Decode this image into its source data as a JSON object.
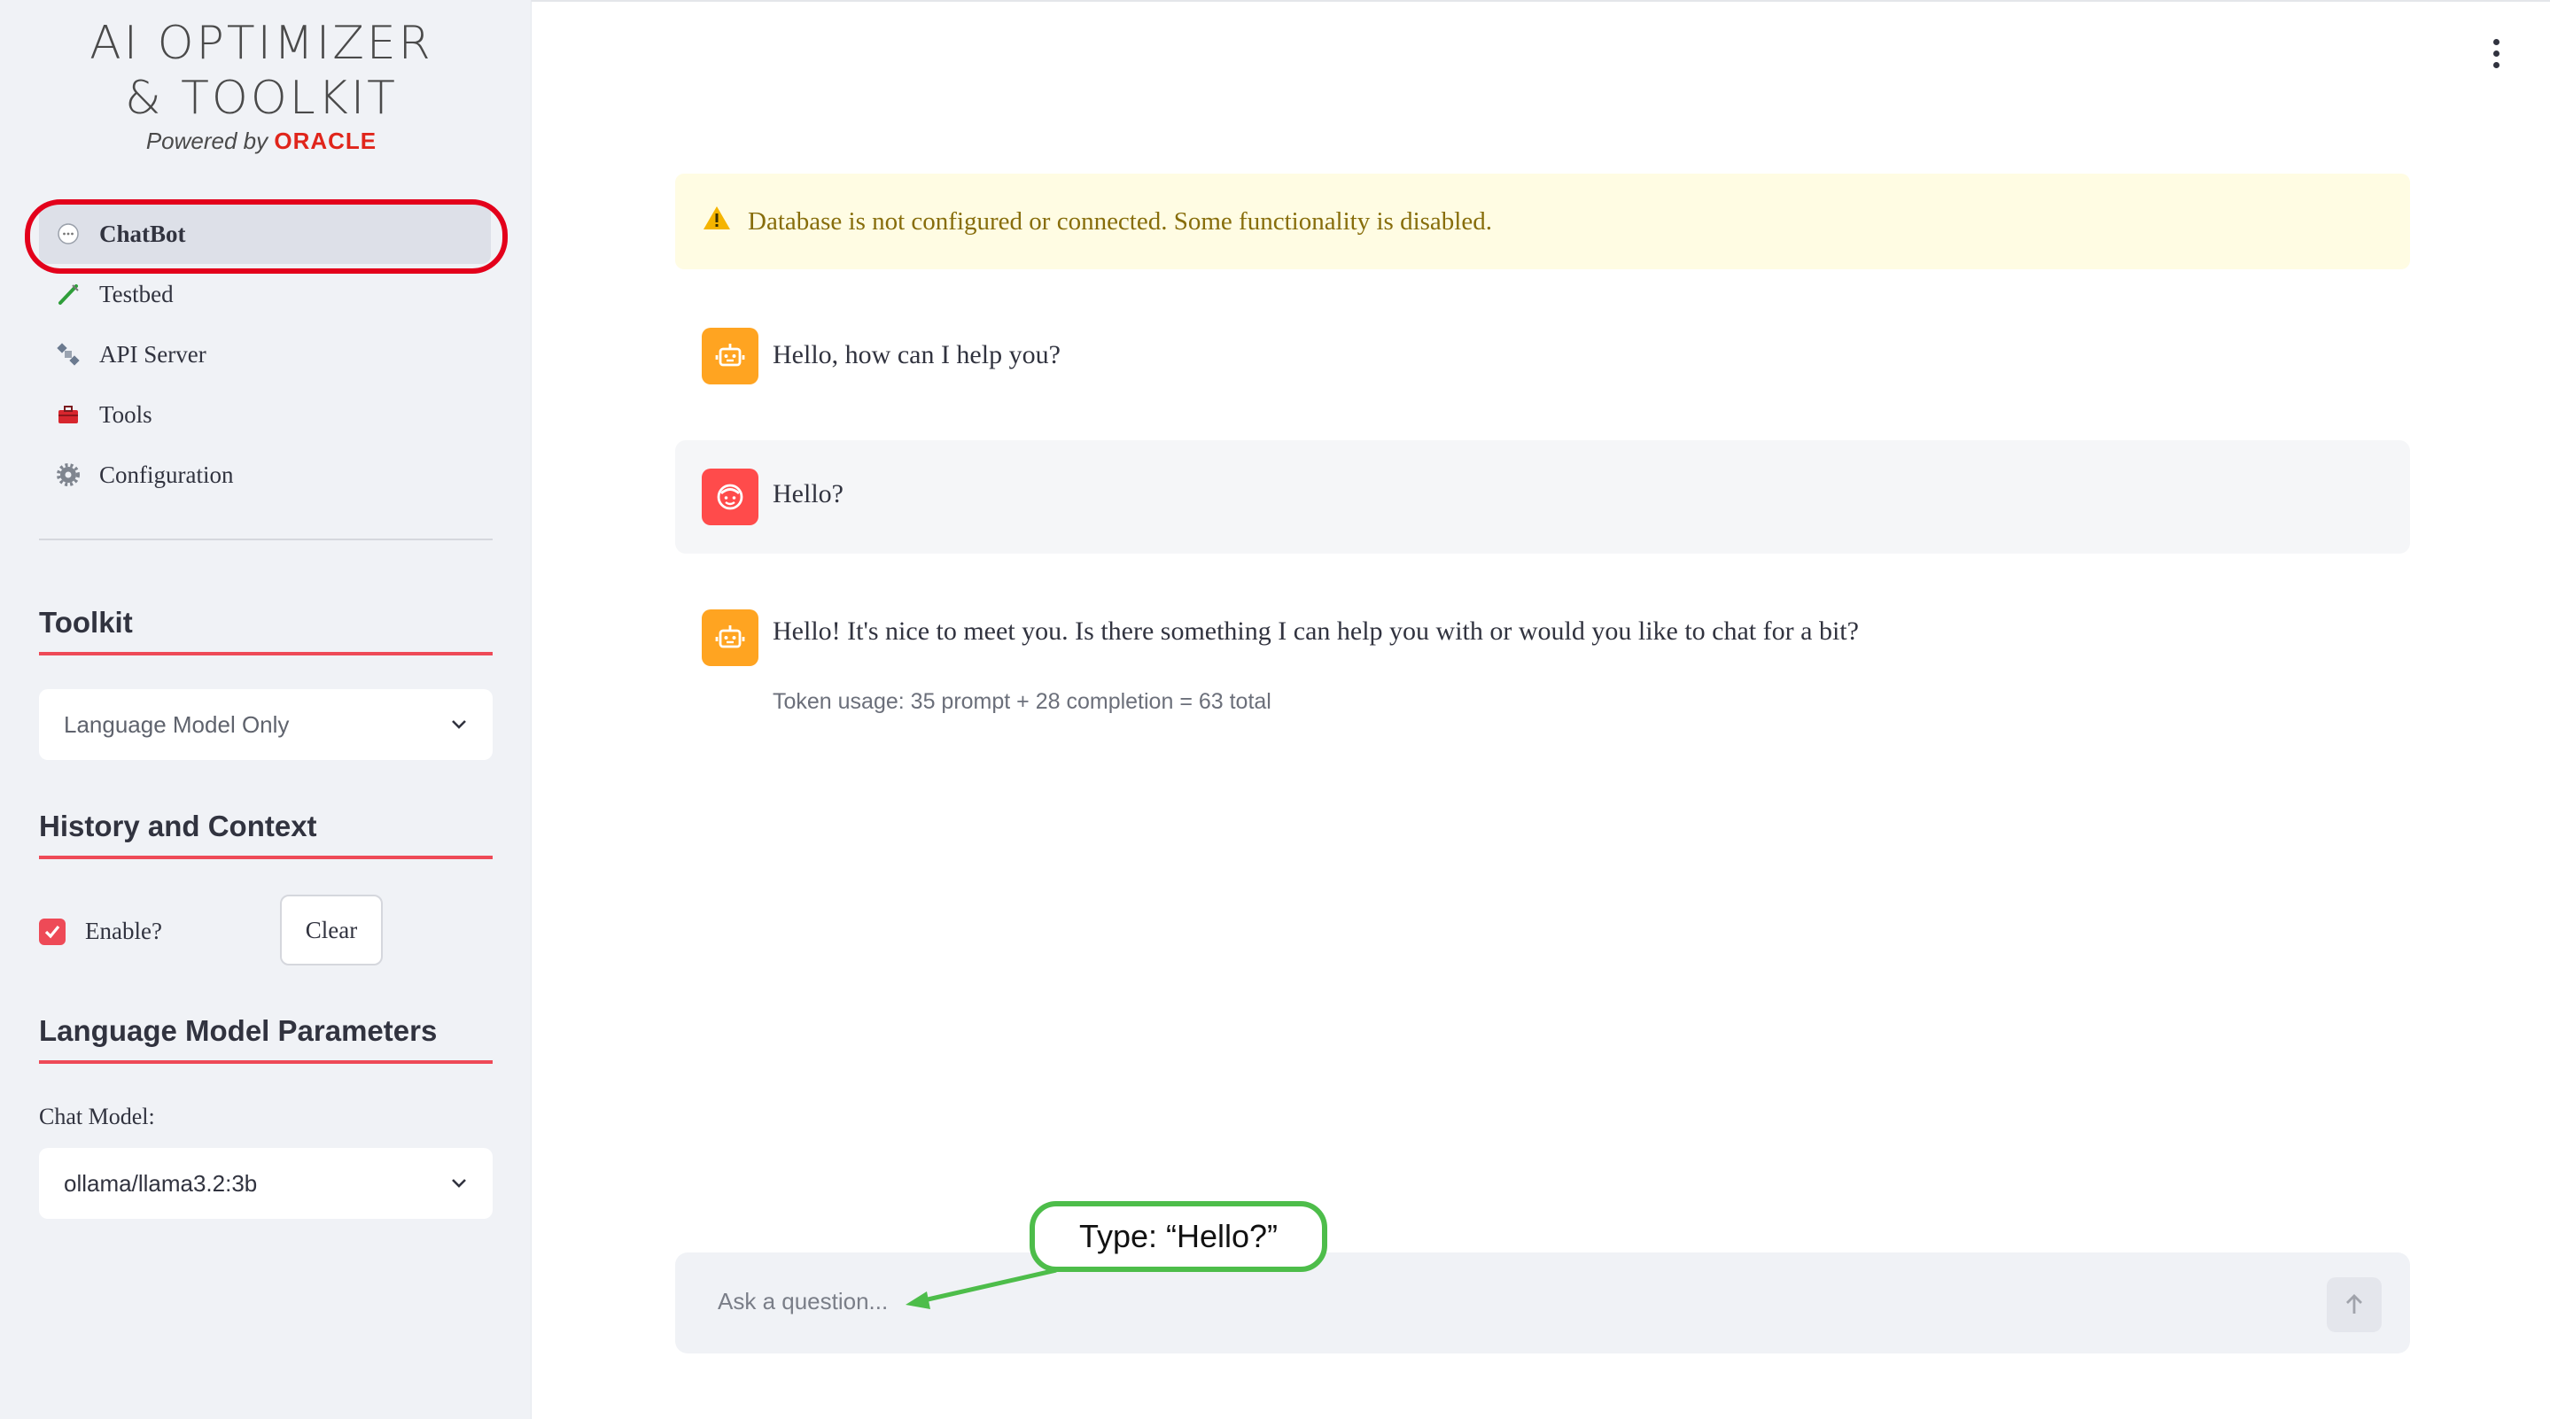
{
  "logo": {
    "line1": "AI OPTIMIZER",
    "line2": "& TOOLKIT",
    "powered_by": "Powered by ",
    "oracle": "ORACLE"
  },
  "nav": {
    "items": [
      {
        "label": "ChatBot",
        "icon": "chat-bubble-icon",
        "active": true
      },
      {
        "label": "Testbed",
        "icon": "test-tube-icon",
        "active": false
      },
      {
        "label": "API Server",
        "icon": "satellite-icon",
        "active": false
      },
      {
        "label": "Tools",
        "icon": "toolbox-icon",
        "active": false
      },
      {
        "label": "Configuration",
        "icon": "gear-icon",
        "active": false
      }
    ]
  },
  "sidebar": {
    "toolkit_title": "Toolkit",
    "toolkit_select_value": "Language Model Only",
    "history_title": "History and Context",
    "enable_label": "Enable?",
    "enable_checked": true,
    "clear_label": "Clear",
    "lm_params_title": "Language Model Parameters",
    "chat_model_label": "Chat Model:",
    "chat_model_value": "ollama/llama3.2:3b"
  },
  "alert": {
    "icon": "warning-icon",
    "text": "Database is not configured or connected. Some functionality is disabled."
  },
  "messages": [
    {
      "role": "assistant",
      "text": "Hello, how can I help you?"
    },
    {
      "role": "user",
      "text": "Hello?"
    },
    {
      "role": "assistant",
      "text": "Hello! It's nice to meet you. Is there something I can help you with or would you like to chat for a bit?",
      "token_usage": "Token usage: 35 prompt + 28 completion = 63 total"
    }
  ],
  "chat_input": {
    "placeholder": "Ask a question..."
  },
  "annotation": {
    "callout_text": "Type: “Hello?”"
  },
  "colors": {
    "accent": "#ee4a57",
    "highlight_ring": "#e3001b",
    "callout_green": "#4dbd4a",
    "bot_avatar": "#ffa421",
    "user_avatar": "#ff4b4b"
  }
}
